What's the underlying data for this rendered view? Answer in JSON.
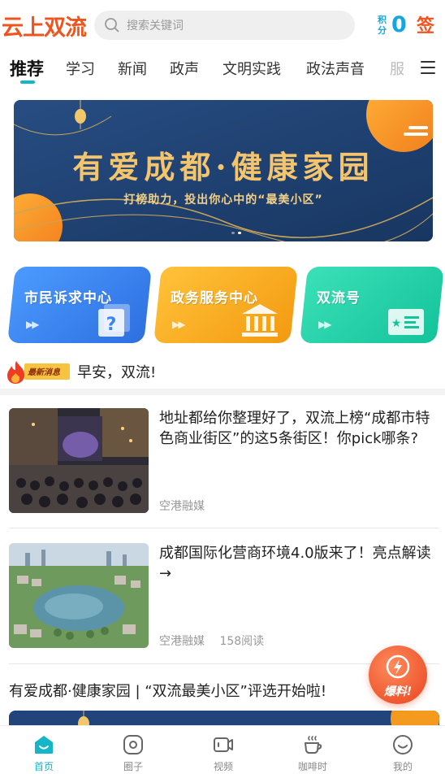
{
  "header": {
    "logo": "云上双流",
    "search_placeholder": "搜索关键词",
    "points_label": "积分",
    "points_value": "0",
    "signin_label": "签"
  },
  "tabs": [
    {
      "label": "推荐",
      "active": true
    },
    {
      "label": "学习"
    },
    {
      "label": "新闻"
    },
    {
      "label": "政声"
    },
    {
      "label": "文明实践"
    },
    {
      "label": "政法声音"
    },
    {
      "label": "服"
    }
  ],
  "banner": {
    "title": "有爱成都·健康家园",
    "subtitle": "打榜助力，投出你心中的“最美小区”",
    "slide_count": 2,
    "active_slide": 2
  },
  "services": [
    {
      "label": "市民诉求中心",
      "color": "#3a86f0",
      "icon": "question-doc-icon"
    },
    {
      "label": "政务服务中心",
      "color": "#f5a91c",
      "icon": "government-building-icon"
    },
    {
      "label": "双流号",
      "color": "#22cfa7",
      "icon": "star-doc-icon"
    }
  ],
  "ticker": {
    "badge": "最新消息",
    "text": "早安，双流!"
  },
  "articles": [
    {
      "title": "地址都给你整理好了，双流上榜“成都市特色商业街区”的这5条街区！你pick哪条?",
      "source": "空港融媒",
      "reads": ""
    },
    {
      "title": "成都国际化营商环境4.0版来了！亮点解读→",
      "source": "空港融媒",
      "reads": "158阅读"
    }
  ],
  "feature": {
    "title": "有爱成都·健康家园 | “双流最美小区”评选开始啦!"
  },
  "report_button": "爆料!",
  "bottom_nav": [
    {
      "label": "首页",
      "icon": "home-icon",
      "active": true
    },
    {
      "label": "圈子",
      "icon": "circle-icon"
    },
    {
      "label": "视频",
      "icon": "video-icon"
    },
    {
      "label": "咖啡时",
      "icon": "coffee-icon"
    },
    {
      "label": "我的",
      "icon": "profile-icon"
    }
  ],
  "colors": {
    "accent": "#16b5c8",
    "brand": "#f0541e",
    "points": "#16a5e0"
  }
}
